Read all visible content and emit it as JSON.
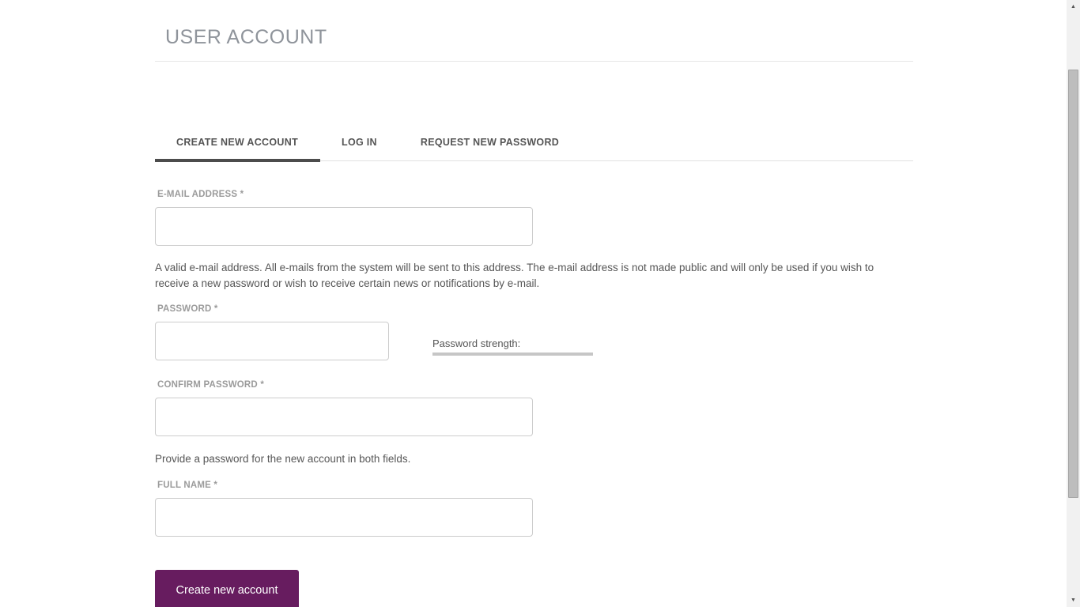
{
  "page": {
    "title": "USER ACCOUNT"
  },
  "tabs": {
    "items": [
      {
        "label": "CREATE NEW ACCOUNT",
        "active": true
      },
      {
        "label": "LOG IN",
        "active": false
      },
      {
        "label": "REQUEST NEW PASSWORD",
        "active": false
      }
    ]
  },
  "form": {
    "email": {
      "label": "E-MAIL ADDRESS *",
      "value": "",
      "description": "A valid e-mail address. All e-mails from the system will be sent to this address. The e-mail address is not made public and will only be used if you wish to receive a new password or wish to receive certain news or notifications by e-mail."
    },
    "password": {
      "label": "PASSWORD *",
      "value": "",
      "strength_label": "Password strength:"
    },
    "confirm_password": {
      "label": "CONFIRM PASSWORD *",
      "value": "",
      "description": "Provide a password for the new account in both fields."
    },
    "full_name": {
      "label": "FULL NAME *",
      "value": ""
    },
    "submit_label": "Create new account"
  },
  "colors": {
    "accent": "#671c5f",
    "active_tab_underline": "#4c4c4c",
    "strength_bar": "#c6c6c6"
  }
}
